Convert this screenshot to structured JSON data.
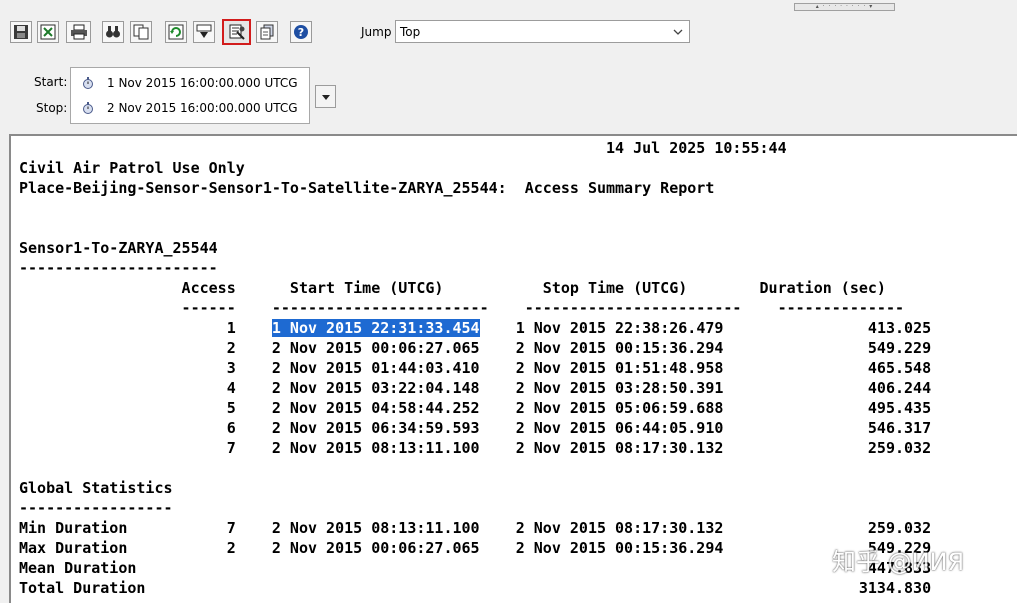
{
  "toolbar": {
    "buttons": [
      {
        "name": "save-icon"
      },
      {
        "name": "export-excel-icon"
      },
      {
        "name": "print-icon"
      },
      {
        "name": "find-icon"
      },
      {
        "name": "copy-icon"
      },
      {
        "name": "refresh-icon"
      },
      {
        "name": "download-icon"
      },
      {
        "name": "report-style-icon",
        "selected": true
      },
      {
        "name": "properties-icon"
      },
      {
        "name": "help-icon"
      }
    ],
    "jump_label": "Jump",
    "jump_value": "Top"
  },
  "time": {
    "start_label": "Start:",
    "start_value": "1 Nov 2015 16:00:00.000 UTCG",
    "stop_label": "Stop:",
    "stop_value": "2 Nov 2015 16:00:00.000 UTCG"
  },
  "report": {
    "date_line": "                                                                 14 Jul 2025 10:55:44",
    "title_line1": "Civil Air Patrol Use Only",
    "title_line2": "Place-Beijing-Sensor-Sensor1-To-Satellite-ZARYA_25544:  Access Summary Report",
    "section_title": "Sensor1-To-ZARYA_25544",
    "section_rule": "----------------------",
    "header_line": "                  Access      Start Time (UTCG)           Stop Time (UTCG)        Duration (sec)",
    "rule_line": "                  ------    ------------------------    ------------------------    --------------",
    "row1_lead": "                       1    ",
    "row1_start": "1 Nov 2015 22:31:33.454",
    "row1_tail": "    1 Nov 2015 22:38:26.479                413.025",
    "rows": [
      "                       2    2 Nov 2015 00:06:27.065    2 Nov 2015 00:15:36.294                549.229",
      "                       3    2 Nov 2015 01:44:03.410    2 Nov 2015 01:51:48.958                465.548",
      "                       4    2 Nov 2015 03:22:04.148    2 Nov 2015 03:28:50.391                406.244",
      "                       5    2 Nov 2015 04:58:44.252    2 Nov 2015 05:06:59.688                495.435",
      "                       6    2 Nov 2015 06:34:59.593    2 Nov 2015 06:44:05.910                546.317",
      "                       7    2 Nov 2015 08:13:11.100    2 Nov 2015 08:17:30.132                259.032"
    ],
    "global_title": "Global Statistics",
    "global_rule": "-----------------",
    "stats": [
      "Min Duration           7    2 Nov 2015 08:13:11.100    2 Nov 2015 08:17:30.132                259.032",
      "Max Duration           2    2 Nov 2015 00:06:27.065    2 Nov 2015 00:15:36.294                549.229",
      "Mean Duration                                                                                 447.833",
      "Total Duration                                                                               3134.830"
    ]
  },
  "watermark": "知乎 @ИИЯ"
}
